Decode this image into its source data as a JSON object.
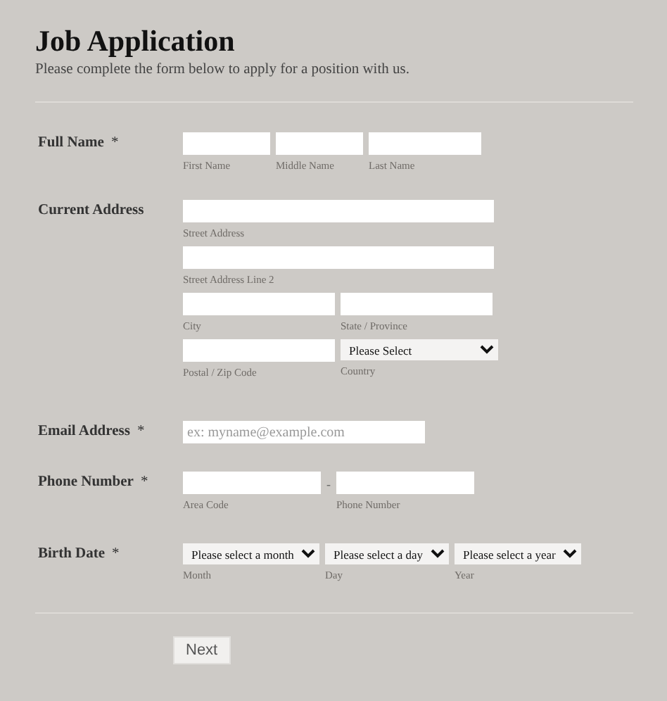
{
  "title": "Job Application",
  "subtitle": "Please complete the form below to apply for a position with us.",
  "sections": [
    {
      "label": "Full Name",
      "required_mark": "*",
      "rows": [
        [
          {
            "kind": "input",
            "sublabel": "First Name"
          },
          {
            "kind": "input",
            "sublabel": "Middle Name"
          },
          {
            "kind": "input",
            "sublabel": "Last Name"
          }
        ]
      ]
    },
    {
      "label": "Current Address",
      "rows": [
        [
          {
            "kind": "input",
            "sublabel": "Street Address"
          }
        ],
        [
          {
            "kind": "input",
            "sublabel": "Street Address Line 2"
          }
        ],
        [
          {
            "kind": "input",
            "sublabel": "City"
          },
          {
            "kind": "input",
            "sublabel": "State / Province"
          }
        ],
        [
          {
            "kind": "input",
            "sublabel": "Postal / Zip Code"
          },
          {
            "kind": "select",
            "value": "Please Select",
            "sublabel": "Country"
          }
        ]
      ]
    },
    {
      "label": "Email Address",
      "required_mark": "*",
      "rows": [
        [
          {
            "kind": "input",
            "placeholder": "ex: myname@example.com"
          }
        ]
      ]
    },
    {
      "label": "Phone Number",
      "required_mark": "*",
      "rows": [
        [
          {
            "kind": "input",
            "sublabel": "Area Code"
          },
          {
            "kind": "separator",
            "text": "-"
          },
          {
            "kind": "input",
            "sublabel": "Phone Number"
          }
        ]
      ]
    },
    {
      "label": "Birth Date",
      "required_mark": "*",
      "rows": [
        [
          {
            "kind": "select",
            "value": "Please select a month",
            "sublabel": "Month"
          },
          {
            "kind": "select",
            "value": "Please select a day",
            "sublabel": "Day"
          },
          {
            "kind": "select",
            "value": "Please select a year",
            "sublabel": "Year"
          }
        ]
      ]
    }
  ],
  "next_button": "Next"
}
